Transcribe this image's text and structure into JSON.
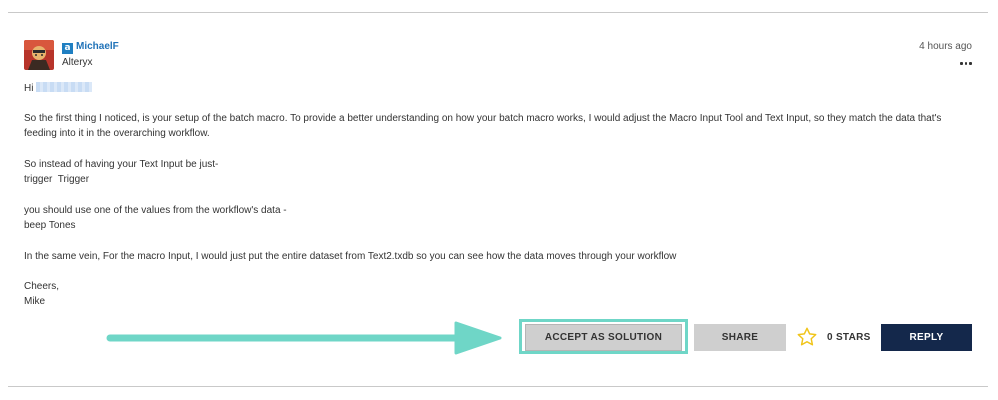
{
  "post": {
    "author": {
      "username": "MichaelF",
      "rank": "Alteryx",
      "role_icon_letter": "a",
      "avatar_icon": "user-avatar-icon",
      "role_icon": "alteryx-employee-icon"
    },
    "timestamp": "4 hours ago",
    "more_icon": "more-options-icon",
    "greeting": "Hi",
    "paragraphs": [
      [
        "So the first thing I noticed, is your setup of the batch macro. To provide a better understanding on how your batch macro works, I would adjust the Macro Input Tool and Text Input, so they match the data that's feeding into it in the overarching workflow."
      ],
      [
        "So instead of having your Text Input be just-",
        "trigger  Trigger"
      ],
      [
        "you should use one of the values from the workflow's data -",
        "beep Tones"
      ],
      [
        "In the same vein, For the macro Input, I would just put the entire dataset from Text2.txdb so you can see how the data moves through your workflow"
      ],
      [
        "Cheers,",
        "Mike"
      ]
    ]
  },
  "actions": {
    "accept_label": "ACCEPT AS SOLUTION",
    "share_label": "SHARE",
    "stars_label": "0 STARS",
    "stars_count": 0,
    "reply_label": "REPLY",
    "star_icon": "star-outline-icon",
    "arrow_icon": "arrow-right-icon"
  },
  "colors": {
    "accent_teal": "#6fd6c7",
    "username_blue": "#1f72b8",
    "reply_navy": "#14284b",
    "star_gold": "#f0c419",
    "button_gray": "#cfcfcf"
  }
}
